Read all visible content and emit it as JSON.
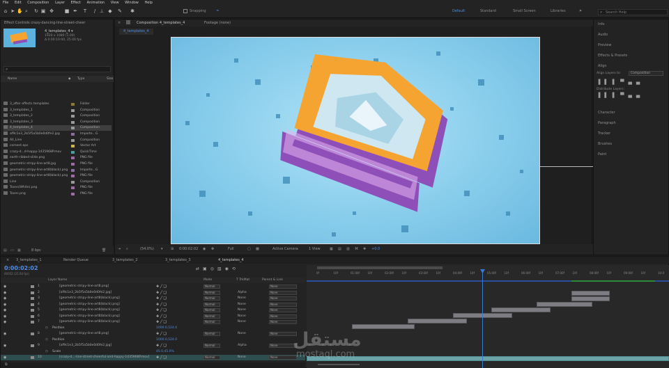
{
  "menu": [
    "File",
    "Edit",
    "Composition",
    "Layer",
    "Effect",
    "Animation",
    "View",
    "Window",
    "Help"
  ],
  "toolbar": {
    "snapping_label": "Snapping",
    "workspaces": [
      "Default",
      "Standard",
      "Small Screen",
      "Libraries"
    ],
    "active_workspace": "Default",
    "search_placeholder": "Search Help"
  },
  "project": {
    "tab": "Effect Controls crazy-dancing-line-street-cheer",
    "selected_name": "4_templates_4 ▾",
    "selected_info1": "1920 x 1080 (1.00)",
    "selected_info2": "Δ 0:00:10:00, 25.00 fps",
    "search_placeholder": "",
    "col_name": "Name",
    "col_type": "Type",
    "col_size": "Size",
    "items": [
      {
        "name": "3_after effects templates",
        "type": "Folder"
      },
      {
        "name": "3_templates_1",
        "type": "Composition"
      },
      {
        "name": "3_templates_2",
        "type": "Composition"
      },
      {
        "name": "3_templates_3",
        "type": "Composition"
      },
      {
        "name": "4_templates_4",
        "type": "Composition"
      },
      {
        "name": "af9c1e3_2b5f5a5b0e0d0fe2.jpg",
        "type": "Importe...G"
      },
      {
        "name": "All_Line",
        "type": "Composition"
      },
      {
        "name": "cement.eps",
        "type": "Vector Art"
      },
      {
        "name": "crazy-d...d-happy-1435968P.mov",
        "type": "QuickTime"
      },
      {
        "name": "earth-ribbed-slide.png",
        "type": "PNG file"
      },
      {
        "name": "geometric-stripy-line-art8.jpg",
        "type": "PNG file"
      },
      {
        "name": "geometric-stripy-line-art8(black).png",
        "type": "Importe...G"
      },
      {
        "name": "geometric-stripy-line-art8(black).png",
        "type": "PNG file"
      },
      {
        "name": "Line",
        "type": "Composition"
      },
      {
        "name": "Toons(White).png",
        "type": "PNG file"
      },
      {
        "name": "Toons.png",
        "type": "PNG file"
      }
    ],
    "bpc": "8 bpc"
  },
  "viewer": {
    "tab_comp": "Composition 4_templates_4",
    "tab_footage": "Footage (none)",
    "breadcrumb": "4_templates_4",
    "zoom": "(54.0%)",
    "timecode": "0:00:02:02",
    "resolution": "Full",
    "camera": "Active Camera",
    "view": "1 View",
    "exposure": "+0.0"
  },
  "right_panels": [
    "Info",
    "Audio",
    "Preview",
    "Effects & Presets",
    "Align",
    "Character",
    "Paragraph",
    "Tracker",
    "Brushes",
    "Paint"
  ],
  "align": {
    "label": "Align Layers to:",
    "target": "Composition",
    "distribute": "Distribute Layers:"
  },
  "timeline": {
    "tabs": [
      "3_templates_1",
      "Render Queue",
      "3_templates_2",
      "3_templates_3",
      "4_templates_4"
    ],
    "timecode": "0:00:02:02",
    "frames": "00052 (25.00 fps)",
    "headers": {
      "layer_name": "Layer Name",
      "mode": "Mode",
      "trkmat": "T TrkMat",
      "parent": "Parent & Link"
    },
    "ruler": [
      "0f",
      "10f",
      "01:00f",
      "10f",
      "02:00f",
      "10f",
      "03:00f",
      "10f",
      "04:00f",
      "10f",
      "05:00f",
      "10f",
      "06:00f",
      "10f",
      "07:00f",
      "10f",
      "08:00f",
      "10f",
      "09:00f",
      "10f",
      "10:0"
    ],
    "rows": [
      {
        "num": "1",
        "name": "[geometric-stripy-line-art8.png]",
        "mode": "Normal",
        "trk": "",
        "parent": "None"
      },
      {
        "num": "2",
        "name": "[af9c1e3_2b5f5a5b0e0d0fe2.jpg]",
        "mode": "Normal",
        "trk": "Alpha",
        "parent": "None"
      },
      {
        "num": "3",
        "name": "[geometric-stripy-line-art8(black).png]",
        "mode": "Normal",
        "trk": "None",
        "parent": "None"
      },
      {
        "num": "4",
        "name": "[geometric-stripy-line-art8(black).png]",
        "mode": "Normal",
        "trk": "None",
        "parent": "None"
      },
      {
        "num": "5",
        "name": "[geometric-stripy-line-art8(black).png]",
        "mode": "Normal",
        "trk": "None",
        "parent": "None"
      },
      {
        "num": "6",
        "name": "[geometric-stripy-line-art8(black).png]",
        "mode": "Normal",
        "trk": "None",
        "parent": "None"
      },
      {
        "num": "7",
        "name": "[geometric-stripy-line-art8(black).png]",
        "mode": "Normal",
        "trk": "None",
        "parent": "None"
      },
      {
        "num": "",
        "name": "Position",
        "prop": "1000.0,524.0"
      },
      {
        "num": "8",
        "name": "[geometric-stripy-line-art8.png]",
        "mode": "Normal",
        "trk": "None",
        "parent": "None"
      },
      {
        "num": "",
        "name": "Position",
        "prop": "1000.0,524.0"
      },
      {
        "num": "9",
        "name": "[af9c1e3_2b5f5a5b0e0d0fe2.jpg]",
        "mode": "Normal",
        "trk": "Alpha",
        "parent": "None"
      },
      {
        "num": "",
        "name": "Scale",
        "prop": "45.0,45.0%"
      },
      {
        "num": "10",
        "name": "[crazy-d...-line-street-cheerful-and-happy-1435968P.mov]",
        "mode": "Normal",
        "trk": "None",
        "parent": "None"
      }
    ]
  },
  "watermark": {
    "arabic": "مستقل",
    "latin": "mostaql.com"
  },
  "colors": {
    "accent": "#4f8ee8",
    "viewer_bg": "#7fc6e6",
    "orange": "#f6a431",
    "purple": "#8f4fb8",
    "playhead": "#3a78d8"
  }
}
